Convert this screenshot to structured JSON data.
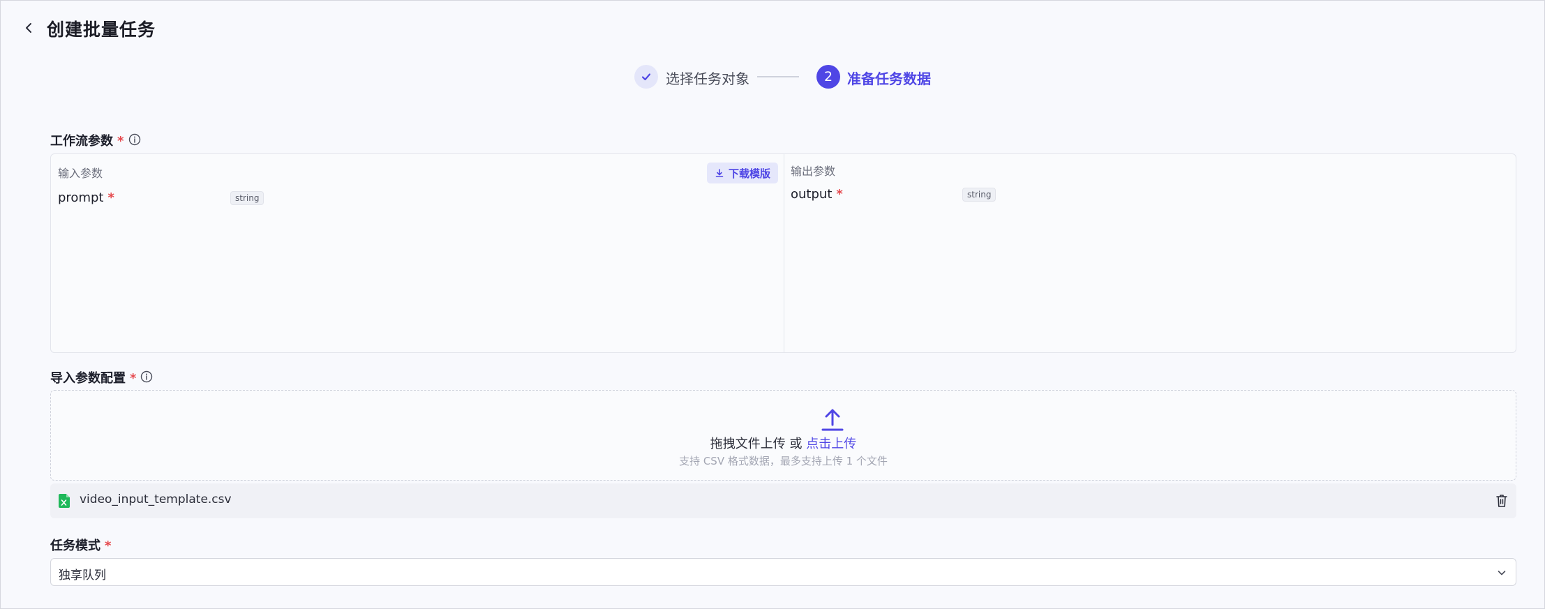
{
  "header": {
    "title": "创建批量任务"
  },
  "steps": [
    {
      "label": "选择任务对象",
      "state": "done"
    },
    {
      "number": "2",
      "label": "准备任务数据",
      "state": "active"
    }
  ],
  "workflow_params": {
    "label": "工作流参数",
    "required_mark": "*",
    "input": {
      "title": "输入参数",
      "download_label": "下载模版",
      "params": [
        {
          "name": "prompt",
          "required_mark": "*",
          "type": "string"
        }
      ]
    },
    "output": {
      "title": "输出参数",
      "params": [
        {
          "name": "output",
          "required_mark": "*",
          "type": "string"
        }
      ]
    }
  },
  "import_config": {
    "label": "导入参数配置",
    "required_mark": "*",
    "upload_text": "拖拽文件上传 或 ",
    "upload_link": "点击上传",
    "upload_hint": "支持 CSV 格式数据，最多支持上传 1 个文件",
    "file_name": "video_input_template.csv"
  },
  "task_mode": {
    "label": "任务模式",
    "required_mark": "*",
    "selected": "独享队列"
  },
  "colors": {
    "accent": "#4f46e5",
    "required": "#e5484d",
    "csv_green": "#1fb85a"
  }
}
